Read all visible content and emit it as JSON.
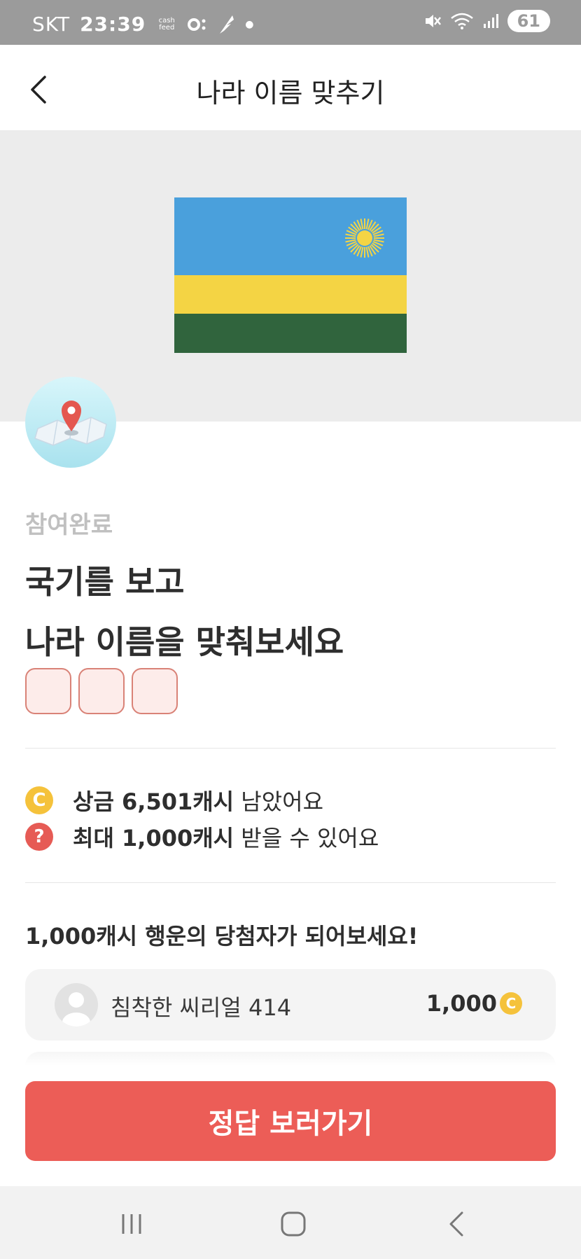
{
  "status_bar": {
    "carrier": "SKT",
    "time": "23:39",
    "cashfeed_top": "cash",
    "cashfeed_bottom": "feed",
    "battery": "61"
  },
  "header": {
    "title": "나라 이름 맞추기"
  },
  "quiz": {
    "status_label": "참여완료",
    "title_line1": "국기를 보고",
    "title_line2": "나라 이름을 맞춰보세요",
    "answer_box_count": 3
  },
  "info": {
    "prize_bold": "상금 6,501캐시",
    "prize_suffix": " 남았어요",
    "max_bold": "최대 1,000캐시",
    "max_suffix": " 받을 수 있어요",
    "coin_glyph": "C",
    "question_glyph": "?"
  },
  "winners": {
    "heading": "1,000캐시 행운의 당첨자가 되어보세요!",
    "items": [
      {
        "name": "침착한 씨리얼 414",
        "amount": "1,000"
      }
    ]
  },
  "cta": {
    "label": "정답 보러가기"
  },
  "colors": {
    "accent": "#ec5d57",
    "coin": "#f5c23b",
    "flag_blue": "#4aa0dc",
    "flag_yellow": "#f4d444",
    "flag_green": "#30643d"
  }
}
